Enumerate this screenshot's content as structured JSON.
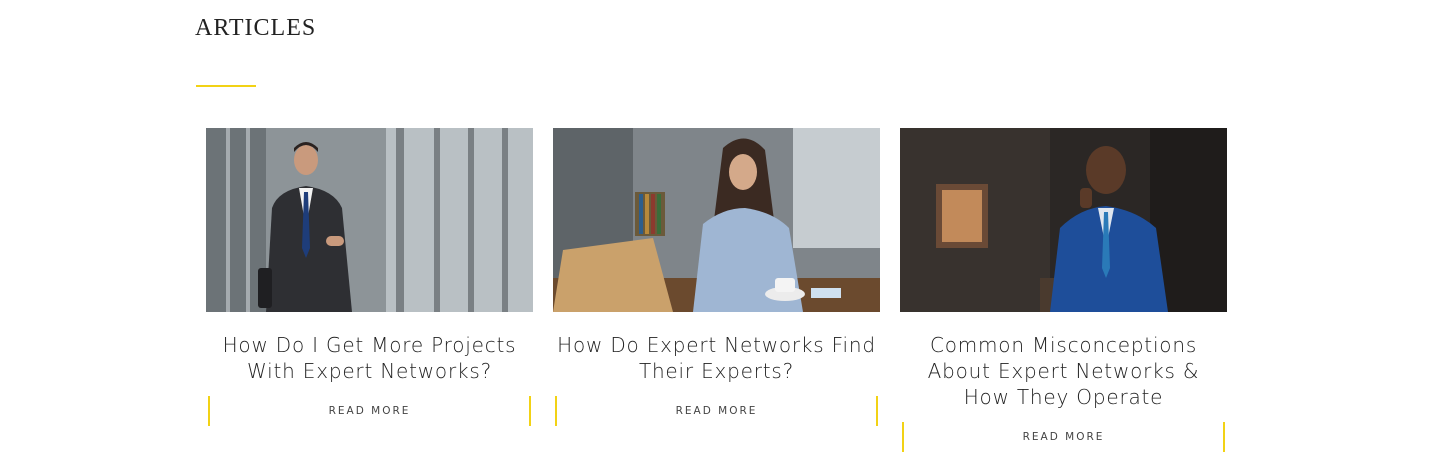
{
  "section": {
    "title": "ARTICLES",
    "accent_color": "#f2d215"
  },
  "articles": [
    {
      "title": "How Do I Get More Projects With Expert Networks?",
      "image": "man-in-suit-on-phone-walking-office",
      "cta": "READ MORE"
    },
    {
      "title": "How Do Expert Networks Find Their Experts?",
      "image": "woman-on-phone-at-laptop-desk",
      "cta": "READ MORE"
    },
    {
      "title": "Common Misconceptions About Expert Networks & How They Operate",
      "image": "smiling-man-in-blue-suit-on-phone",
      "cta": "READ MORE"
    }
  ]
}
